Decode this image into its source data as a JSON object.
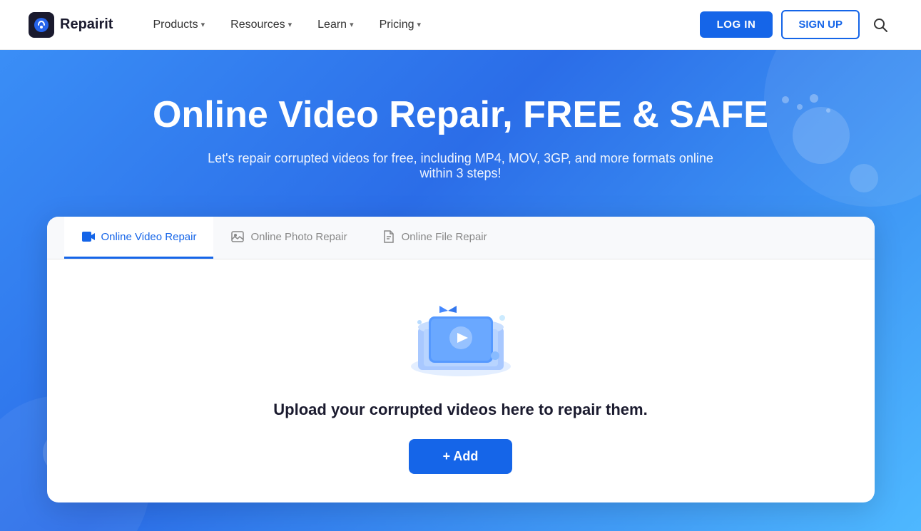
{
  "navbar": {
    "logo_text": "Repairit",
    "logo_icon": "🔧",
    "nav_items": [
      {
        "label": "Products",
        "has_dropdown": true
      },
      {
        "label": "Resources",
        "has_dropdown": true
      },
      {
        "label": "Learn",
        "has_dropdown": true
      },
      {
        "label": "Pricing",
        "has_dropdown": true
      }
    ],
    "login_label": "LOG IN",
    "signup_label": "SIGN UP"
  },
  "hero": {
    "title": "Online Video Repair, FREE & SAFE",
    "subtitle": "Let's repair corrupted videos for free, including MP4, MOV, 3GP, and more formats online within 3 steps!"
  },
  "card": {
    "tabs": [
      {
        "label": "Online Video Repair",
        "active": true
      },
      {
        "label": "Online Photo Repair",
        "active": false
      },
      {
        "label": "Online File Repair",
        "active": false
      }
    ],
    "upload_text": "Upload your corrupted videos here to repair them.",
    "add_label": "+ Add"
  }
}
